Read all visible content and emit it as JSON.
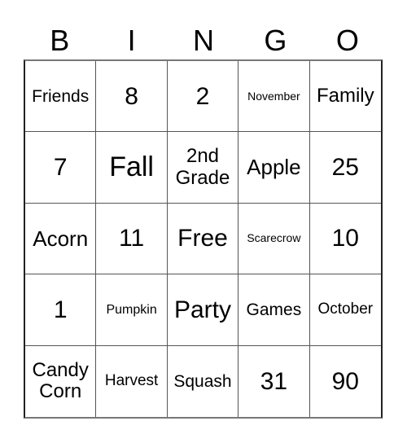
{
  "header": {
    "letters": [
      "B",
      "I",
      "N",
      "G",
      "O"
    ]
  },
  "card": {
    "cells": [
      [
        "Friends",
        "8",
        "2",
        "November",
        "Family"
      ],
      [
        "7",
        "Fall",
        "2nd Grade",
        "Apple",
        "25"
      ],
      [
        "Acorn",
        "11",
        "Free",
        "Scarecrow",
        "10"
      ],
      [
        "1",
        "Pumpkin",
        "Party",
        "Games",
        "October"
      ],
      [
        "Candy Corn",
        "Harvest",
        "Squash",
        "31",
        "90"
      ]
    ]
  }
}
